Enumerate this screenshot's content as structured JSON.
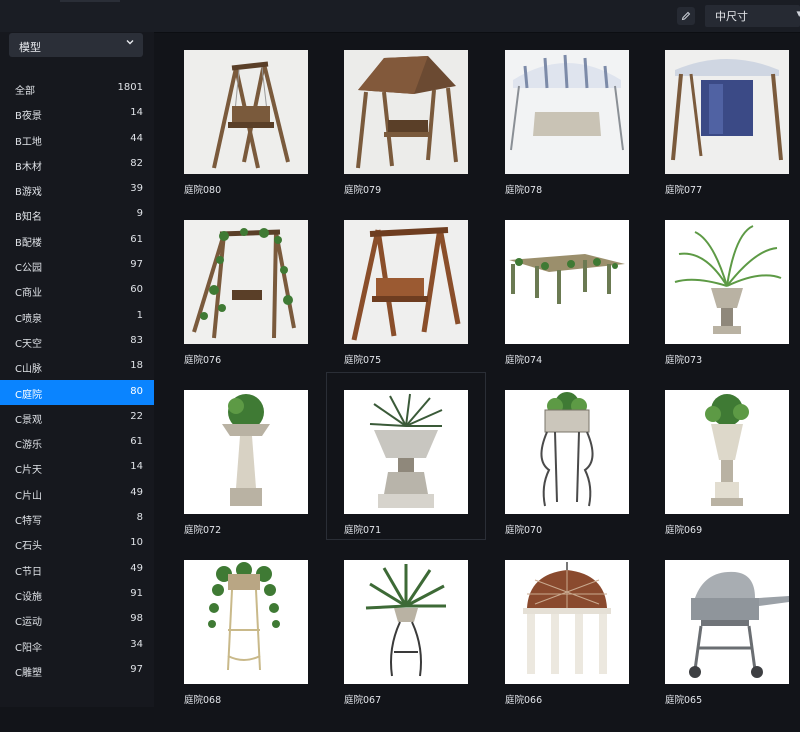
{
  "toolbar": {
    "size_select_value": "中尺寸",
    "edit_icon": "pencil-icon",
    "size_chevron_icon": "chevron-down-icon"
  },
  "sidebar": {
    "dropdown_value": "模型",
    "dropdown_icon": "chevron-down-icon",
    "accent_color": "#0a84ff",
    "categories": [
      {
        "name": "全部",
        "count": "1801"
      },
      {
        "name": "B夜景",
        "count": "14"
      },
      {
        "name": "B工地",
        "count": "44"
      },
      {
        "name": "B木材",
        "count": "82"
      },
      {
        "name": "B游戏",
        "count": "39"
      },
      {
        "name": "B知名",
        "count": "9"
      },
      {
        "name": "B配楼",
        "count": "61"
      },
      {
        "name": "C公园",
        "count": "97"
      },
      {
        "name": "C商业",
        "count": "60"
      },
      {
        "name": "C喷泉",
        "count": "1"
      },
      {
        "name": "C天空",
        "count": "83"
      },
      {
        "name": "C山脉",
        "count": "18"
      },
      {
        "name": "C庭院",
        "count": "80",
        "active": true
      },
      {
        "name": "C景观",
        "count": "22"
      },
      {
        "name": "C游乐",
        "count": "61"
      },
      {
        "name": "C片天",
        "count": "14"
      },
      {
        "name": "C片山",
        "count": "49"
      },
      {
        "name": "C特写",
        "count": "8"
      },
      {
        "name": "C石头",
        "count": "10"
      },
      {
        "name": "C节日",
        "count": "49"
      },
      {
        "name": "C设施",
        "count": "91"
      },
      {
        "name": "C运动",
        "count": "98"
      },
      {
        "name": "C阳伞",
        "count": "34"
      },
      {
        "name": "C雕塑",
        "count": "97"
      }
    ]
  },
  "items": [
    {
      "caption": "庭院080",
      "kind": "swing-wood"
    },
    {
      "caption": "庭院079",
      "kind": "swing-roof"
    },
    {
      "caption": "庭院078",
      "kind": "swing-canopy"
    },
    {
      "caption": "庭院077",
      "kind": "swing-hammock"
    },
    {
      "caption": "庭院076",
      "kind": "swing-ivy"
    },
    {
      "caption": "庭院075",
      "kind": "swing-frame"
    },
    {
      "caption": "庭院074",
      "kind": "pergola"
    },
    {
      "caption": "庭院073",
      "kind": "palm-urn"
    },
    {
      "caption": "庭院072",
      "kind": "pedestal-planter"
    },
    {
      "caption": "庭院071",
      "kind": "stone-urn"
    },
    {
      "caption": "庭院070",
      "kind": "iron-planter"
    },
    {
      "caption": "庭院069",
      "kind": "tall-urn"
    },
    {
      "caption": "庭院068",
      "kind": "hanging-planter"
    },
    {
      "caption": "庭院067",
      "kind": "agave-stand"
    },
    {
      "caption": "庭院066",
      "kind": "gazebo"
    },
    {
      "caption": "庭院065",
      "kind": "grill"
    }
  ]
}
